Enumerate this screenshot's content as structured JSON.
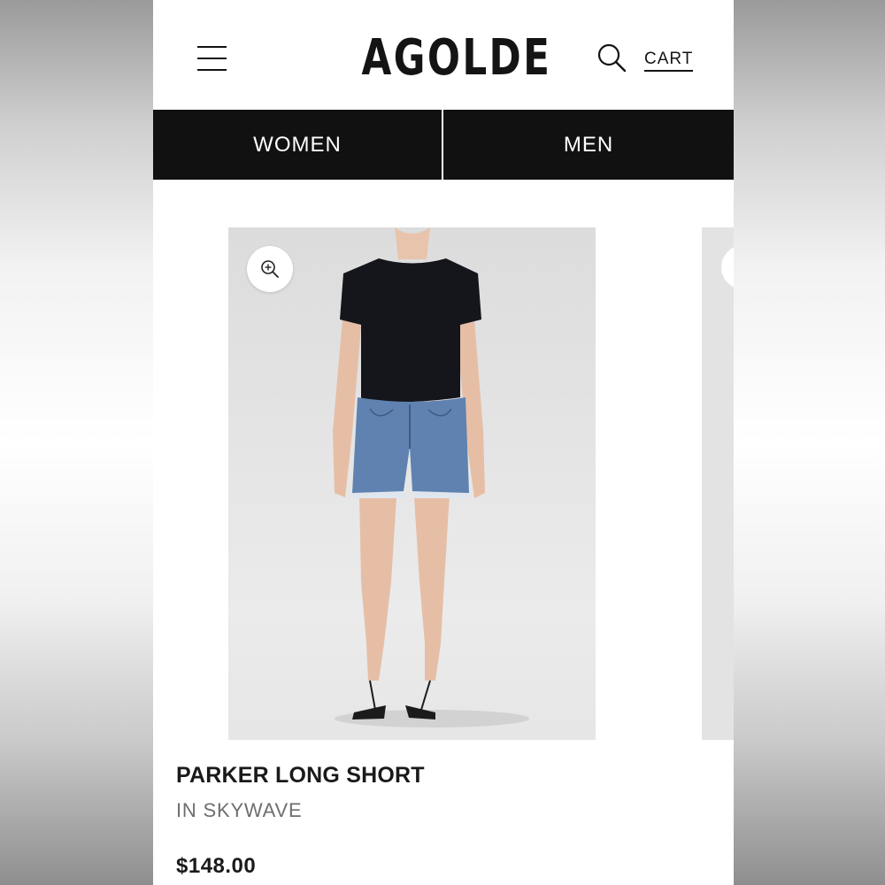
{
  "header": {
    "logo": "AGOLDE",
    "cart_label": "CART",
    "menu_icon": "hamburger-menu-icon",
    "search_icon": "search-icon"
  },
  "nav": {
    "tabs": [
      {
        "label": "WOMEN"
      },
      {
        "label": "MEN"
      }
    ]
  },
  "product": {
    "name": "PARKER LONG SHORT",
    "color": "IN SKYWAVE",
    "price": "$148.00",
    "zoom_icon": "zoom-in-icon"
  },
  "colors": {
    "nav_background": "#111111",
    "text_primary": "#1a1a1a",
    "text_secondary": "#6e6e6e",
    "denim": "#5f82b0",
    "shirt": "#15161c"
  }
}
